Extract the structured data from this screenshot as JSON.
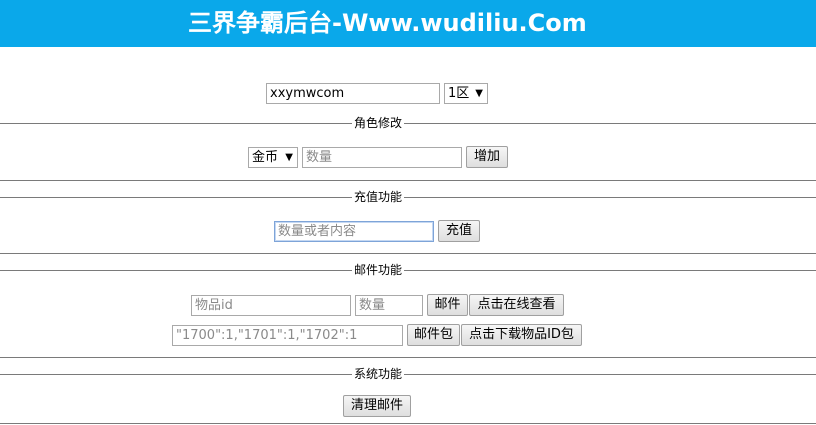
{
  "header": {
    "title": "三界争霸后台-Www.wudiliu.Com"
  },
  "account": {
    "username_value": "xxymwcom",
    "zone_selected": "1区"
  },
  "role": {
    "legend": "角色修改",
    "currency_selected": "金币",
    "amount_placeholder": "数量",
    "add_button": "增加"
  },
  "recharge": {
    "legend": "充值功能",
    "input_placeholder": "数量或者内容",
    "recharge_button": "充值"
  },
  "mail": {
    "legend": "邮件功能",
    "item_id_placeholder": "物品id",
    "quantity_placeholder": "数量",
    "mail_button": "邮件",
    "view_online_button": "点击在线查看",
    "package_value": "\"1700\":1,\"1701\":1,\"1702\":1",
    "package_button": "邮件包",
    "download_ids_button": "点击下载物品ID包"
  },
  "system": {
    "legend": "系统功能",
    "clear_mail_button": "清理邮件"
  }
}
